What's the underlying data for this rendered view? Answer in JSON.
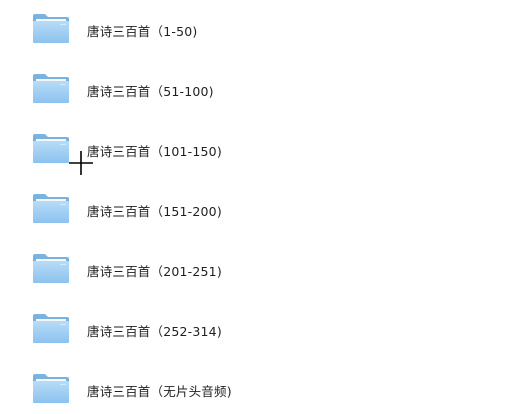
{
  "folders": [
    {
      "name": "唐诗三百首（1-50)"
    },
    {
      "name": "唐诗三百首（51-100)"
    },
    {
      "name": "唐诗三百首（101-150)"
    },
    {
      "name": "唐诗三百首（151-200)"
    },
    {
      "name": "唐诗三百首（201-251)"
    },
    {
      "name": "唐诗三百首（252-314)"
    },
    {
      "name": "唐诗三百首（无片头音频)"
    }
  ],
  "icons": {
    "folder": "folder-icon",
    "cursor": "crosshair-cursor-icon"
  },
  "colors": {
    "folder_back": "#6fa9d8",
    "folder_front": "#9fcdf2",
    "text": "#1f1f1f"
  }
}
